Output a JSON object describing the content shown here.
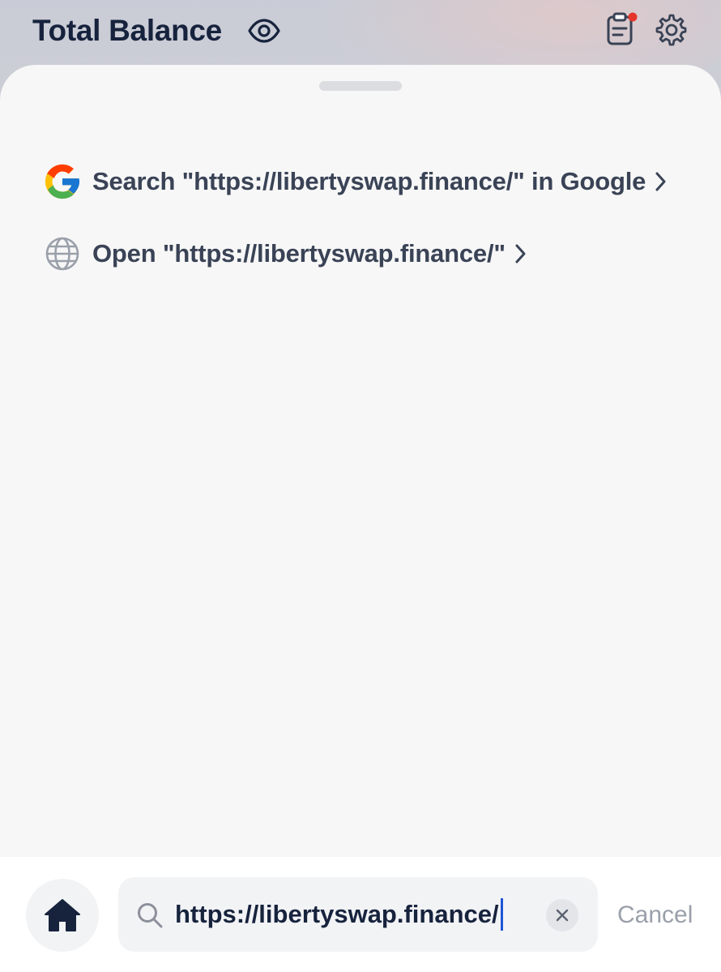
{
  "header": {
    "title": "Total Balance",
    "icons": {
      "visibility": "eye-icon",
      "notes": "clipboard-icon",
      "notification_dot_color": "#e5352b",
      "settings": "gear-icon"
    }
  },
  "suggestions": [
    {
      "label": "Search \"https://libertyswap.finance/\" in Google",
      "icon": "google-icon"
    },
    {
      "label": "Open \"https://libertyswap.finance/\"",
      "icon": "globe-icon"
    }
  ],
  "bottom_bar": {
    "home_icon": "home-icon",
    "search": {
      "value": "https://libertyswap.finance/",
      "icon": "search-icon"
    },
    "cancel_label": "Cancel"
  },
  "colors": {
    "title_text": "#17233d",
    "suggestion_text": "#3a4356",
    "caret": "#1e56d6",
    "cancel_text": "#9aa0aa",
    "sheet_bg": "#f7f7f7"
  }
}
